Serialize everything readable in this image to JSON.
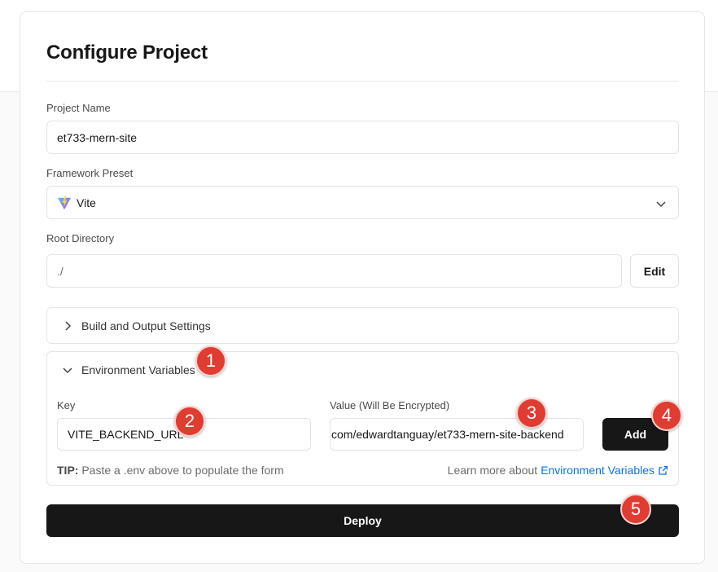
{
  "form": {
    "title": "Configure Project",
    "project_name_label": "Project Name",
    "project_name_value": "et733-mern-site",
    "framework_label": "Framework Preset",
    "framework_value": "Vite",
    "root_dir_label": "Root Directory",
    "root_dir_value": "./",
    "edit_label": "Edit"
  },
  "build_section": {
    "label": "Build and Output Settings"
  },
  "env_section": {
    "label": "Environment Variables",
    "key_label": "Key",
    "key_value": "VITE_BACKEND_URL",
    "value_label": "Value (Will Be Encrypted)",
    "value_value": "com/edwardtanguay/et733-mern-site-backend",
    "add_label": "Add",
    "tip_prefix": "TIP:",
    "tip_text": " Paste a .env above to populate the form",
    "learn_text": "Learn more about",
    "learn_link": "Environment Variables"
  },
  "deploy_label": "Deploy",
  "annotations": [
    "1",
    "2",
    "3",
    "4",
    "5"
  ],
  "colors": {
    "primary_dark": "#171717",
    "link": "#0a72ef",
    "badge": "#e03c31"
  }
}
